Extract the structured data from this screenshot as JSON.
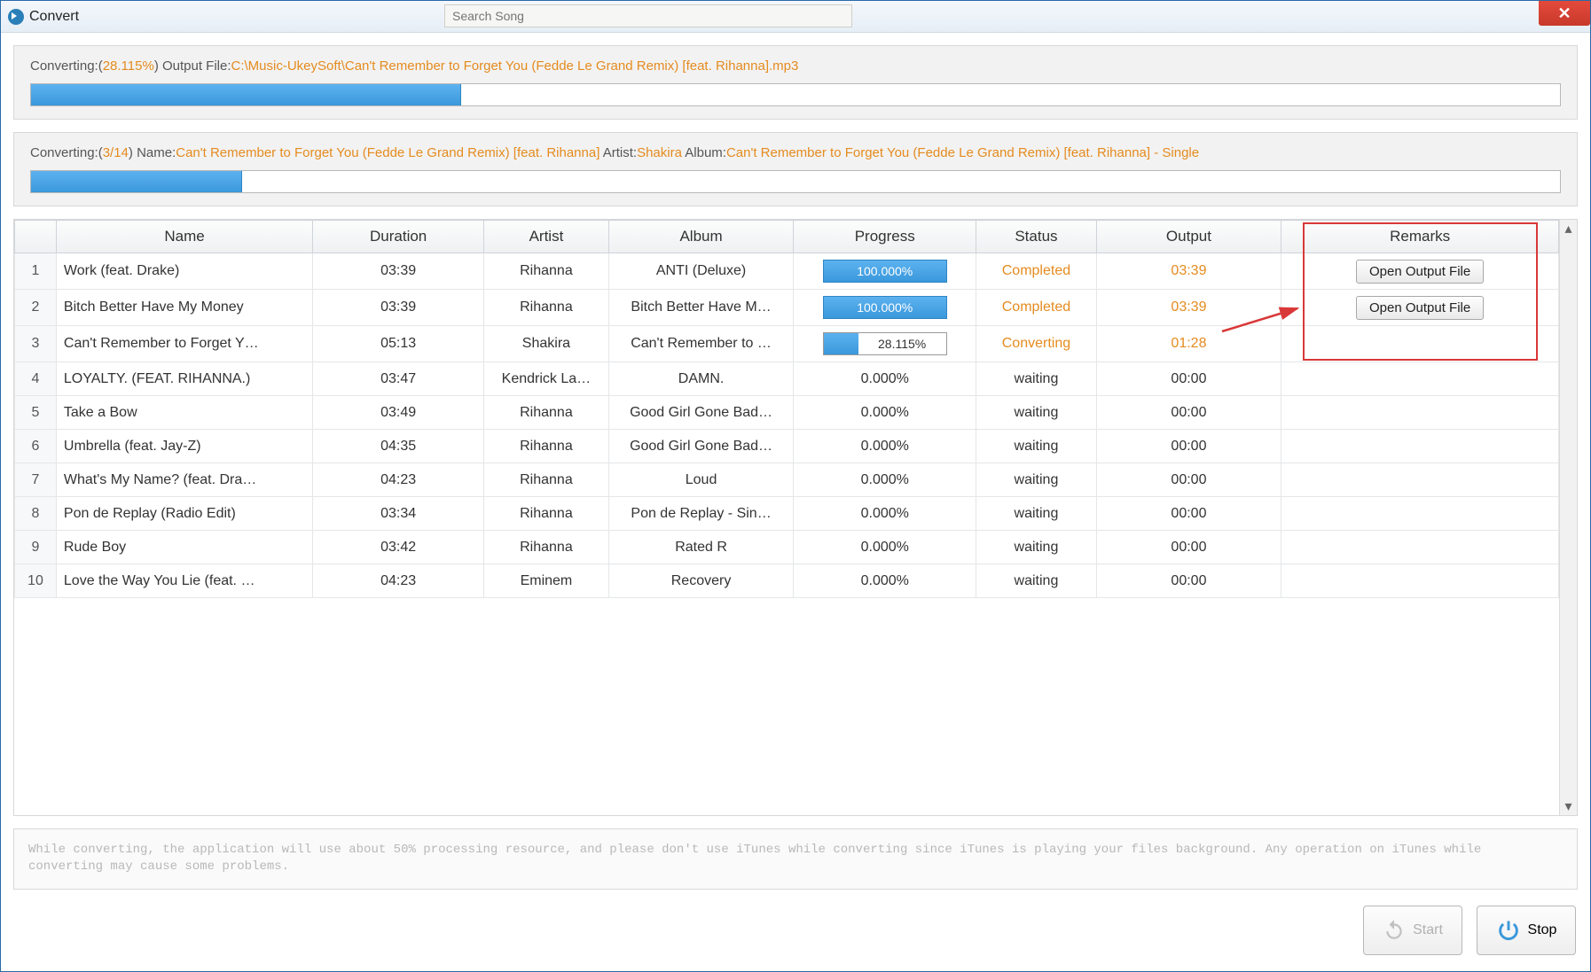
{
  "window": {
    "title": "Convert",
    "search_placeholder": "Search Song"
  },
  "status1": {
    "prefix": "Converting:(",
    "percent": "28.115%",
    "mid": ") Output File:",
    "path": "C:\\Music-UkeySoft\\Can't Remember to Forget You (Fedde Le Grand Remix) [feat. Rihanna].mp3",
    "progress_pct": 28.115
  },
  "status2": {
    "prefix": "Converting:(",
    "count": "3/14",
    "mid1": ") Name:",
    "name": "Can't Remember to Forget You (Fedde Le Grand Remix) [feat. Rihanna]",
    "mid2": " Artist:",
    "artist": "Shakira",
    "mid3": " Album:",
    "album": "Can't Remember to Forget You (Fedde Le Grand Remix) [feat. Rihanna] - Single",
    "progress_pct": 13.8
  },
  "columns": [
    "",
    "Name",
    "Duration",
    "Artist",
    "Album",
    "Progress",
    "Status",
    "Output",
    "Remarks"
  ],
  "rows": [
    {
      "num": "1",
      "name": "Work (feat. Drake)",
      "duration": "03:39",
      "artist": "Rihanna",
      "album": "ANTI (Deluxe)",
      "progress": "100.000%",
      "progress_pct": 100,
      "status": "Completed",
      "status_orange": true,
      "output": "03:39",
      "output_orange": true,
      "remarks": "Open Output File"
    },
    {
      "num": "2",
      "name": "Bitch Better Have My Money",
      "duration": "03:39",
      "artist": "Rihanna",
      "album": "Bitch Better Have M…",
      "progress": "100.000%",
      "progress_pct": 100,
      "status": "Completed",
      "status_orange": true,
      "output": "03:39",
      "output_orange": true,
      "remarks": "Open Output File"
    },
    {
      "num": "3",
      "name": "Can't Remember to Forget Y…",
      "duration": "05:13",
      "artist": "Shakira",
      "album": "Can't Remember to …",
      "progress": "28.115%",
      "progress_pct": 28.115,
      "status": "Converting",
      "status_orange": true,
      "output": "01:28",
      "output_orange": true,
      "remarks": ""
    },
    {
      "num": "4",
      "name": "LOYALTY. (FEAT. RIHANNA.)",
      "duration": "03:47",
      "artist": "Kendrick La…",
      "album": "DAMN.",
      "progress": "0.000%",
      "progress_pct": 0,
      "status": "waiting",
      "status_orange": false,
      "output": "00:00",
      "output_orange": false,
      "remarks": ""
    },
    {
      "num": "5",
      "name": "Take a Bow",
      "duration": "03:49",
      "artist": "Rihanna",
      "album": "Good Girl Gone Bad…",
      "progress": "0.000%",
      "progress_pct": 0,
      "status": "waiting",
      "status_orange": false,
      "output": "00:00",
      "output_orange": false,
      "remarks": ""
    },
    {
      "num": "6",
      "name": "Umbrella (feat. Jay-Z)",
      "duration": "04:35",
      "artist": "Rihanna",
      "album": "Good Girl Gone Bad…",
      "progress": "0.000%",
      "progress_pct": 0,
      "status": "waiting",
      "status_orange": false,
      "output": "00:00",
      "output_orange": false,
      "remarks": ""
    },
    {
      "num": "7",
      "name": "What's My Name? (feat. Dra…",
      "duration": "04:23",
      "artist": "Rihanna",
      "album": "Loud",
      "progress": "0.000%",
      "progress_pct": 0,
      "status": "waiting",
      "status_orange": false,
      "output": "00:00",
      "output_orange": false,
      "remarks": ""
    },
    {
      "num": "8",
      "name": "Pon de Replay (Radio Edit)",
      "duration": "03:34",
      "artist": "Rihanna",
      "album": "Pon de Replay - Sin…",
      "progress": "0.000%",
      "progress_pct": 0,
      "status": "waiting",
      "status_orange": false,
      "output": "00:00",
      "output_orange": false,
      "remarks": ""
    },
    {
      "num": "9",
      "name": "Rude Boy",
      "duration": "03:42",
      "artist": "Rihanna",
      "album": "Rated R",
      "progress": "0.000%",
      "progress_pct": 0,
      "status": "waiting",
      "status_orange": false,
      "output": "00:00",
      "output_orange": false,
      "remarks": ""
    },
    {
      "num": "10",
      "name": "Love the Way You Lie (feat. …",
      "duration": "04:23",
      "artist": "Eminem",
      "album": "Recovery",
      "progress": "0.000%",
      "progress_pct": 0,
      "status": "waiting",
      "status_orange": false,
      "output": "00:00",
      "output_orange": false,
      "remarks": ""
    }
  ],
  "note": "While converting, the application will use about 50% processing resource, and please don't use iTunes while converting since iTunes is playing your files background. Any operation on iTunes while converting may cause some problems.",
  "buttons": {
    "start": "Start",
    "stop": "Stop",
    "open_output": "Open Output File"
  }
}
